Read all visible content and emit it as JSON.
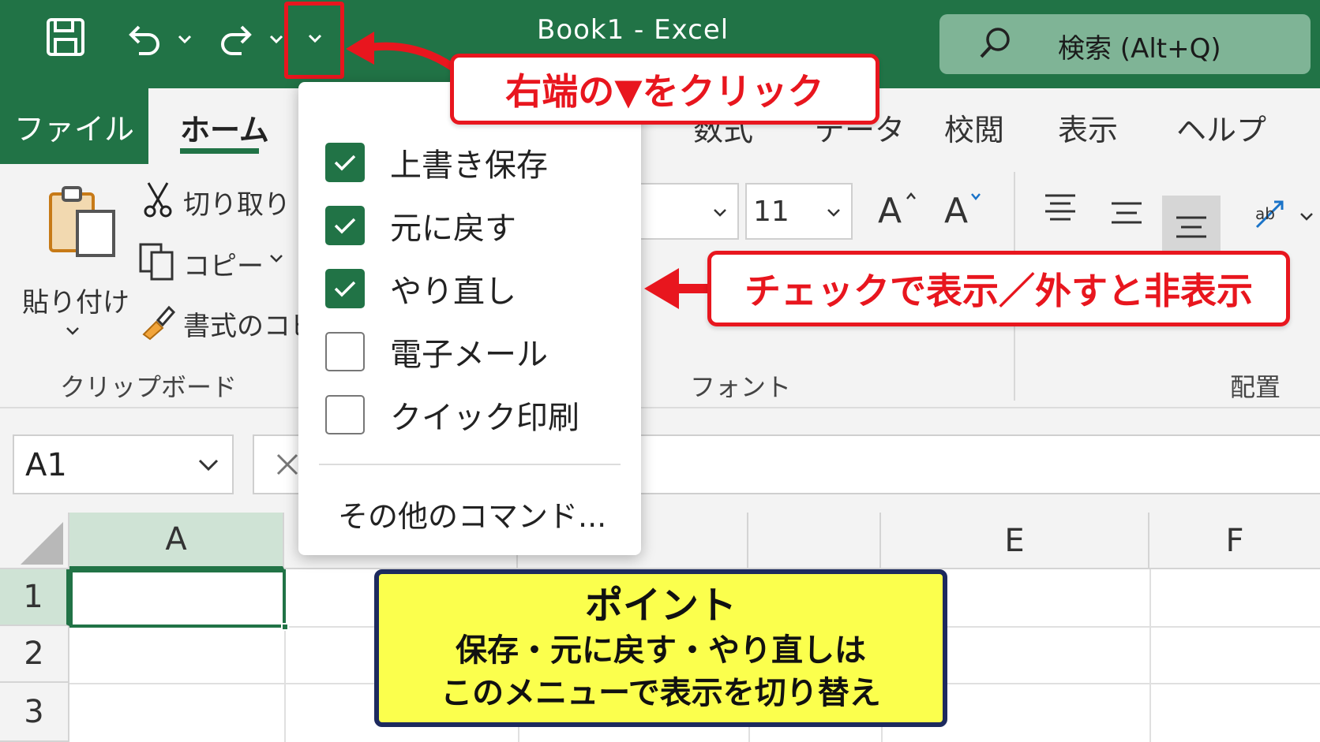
{
  "window": {
    "title": "Book1  -  Excel",
    "search_placeholder": "検索 (Alt+Q)"
  },
  "tabs": {
    "file": "ファイル",
    "home": "ホーム",
    "formulas": "数式",
    "data": "データ",
    "review": "校閲",
    "view": "表示",
    "help": "ヘルプ"
  },
  "ribbon": {
    "paste": "貼り付け",
    "cut": "切り取り",
    "copy": "コピー",
    "format_painter": "書式のコピー",
    "clipboard_group": "クリップボード",
    "font_size": "11",
    "font_group": "フォント",
    "align_group": "配置",
    "grow_font": "A",
    "shrink_font": "A"
  },
  "formula_bar": {
    "name_box": "A1"
  },
  "grid": {
    "columns": [
      "A",
      "E",
      "F"
    ],
    "rows": [
      "1",
      "2",
      "3"
    ]
  },
  "qat_menu": {
    "items": [
      {
        "label": "上書き保存",
        "checked": true
      },
      {
        "label": "元に戻す",
        "checked": true
      },
      {
        "label": "やり直し",
        "checked": true
      },
      {
        "label": "電子メール",
        "checked": false
      },
      {
        "label": "クイック印刷",
        "checked": false
      }
    ],
    "more_commands": "その他のコマンド..."
  },
  "annotations": {
    "click_callout": "右端の▼をクリック",
    "check_callout": "チェックで表示／外すと非表示",
    "point_title": "ポイント",
    "point_line1": "保存・元に戻す・やり直しは",
    "point_line2": "このメニューで表示を切り替え",
    "accent_color": "#e8161e",
    "excel_green": "#217346",
    "point_bg": "#fbff4d"
  }
}
